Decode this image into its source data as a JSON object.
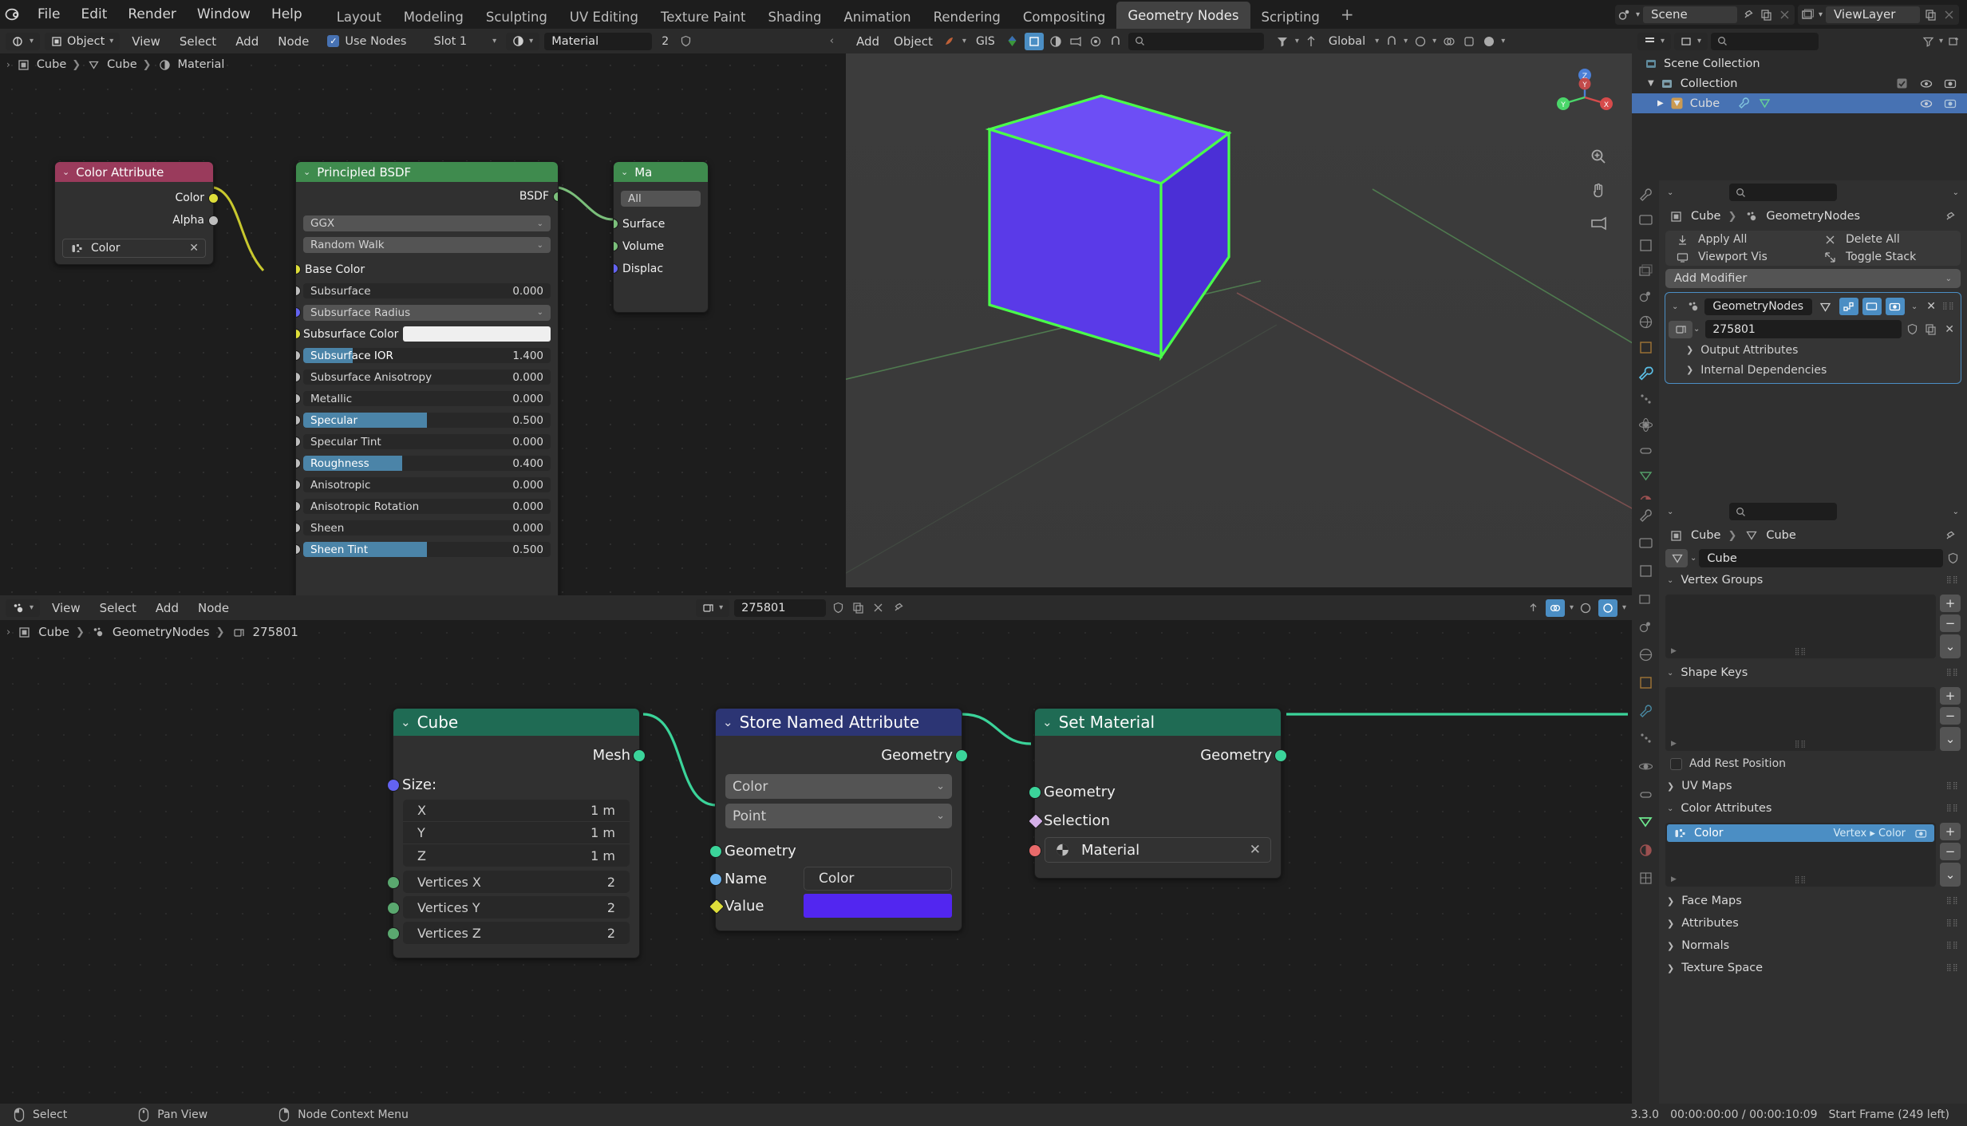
{
  "topbar": {
    "menus": [
      "File",
      "Edit",
      "Render",
      "Window",
      "Help"
    ],
    "workspaces": [
      "Layout",
      "Modeling",
      "Sculpting",
      "UV Editing",
      "Texture Paint",
      "Shading",
      "Animation",
      "Rendering",
      "Compositing",
      "Geometry Nodes",
      "Scripting"
    ],
    "active_workspace": "Geometry Nodes",
    "add_workspace": "+",
    "scene_name": "Scene",
    "viewlayer_name": "ViewLayer"
  },
  "shader_editor": {
    "header": {
      "mode": "Object",
      "menus": [
        "View",
        "Select",
        "Add",
        "Node"
      ],
      "use_nodes_label": "Use Nodes",
      "use_nodes_checked": true,
      "slot": "Slot 1",
      "material_name": "Material",
      "material_users": "2"
    },
    "breadcrumb": [
      "Cube",
      "Cube",
      "Material"
    ],
    "nodes": {
      "color_attribute": {
        "title": "Color Attribute",
        "header_color": "#9a3b5c",
        "outputs": [
          "Color",
          "Alpha"
        ],
        "attribute_name": "Color"
      },
      "principled": {
        "title": "Principled BSDF",
        "header_color": "#3f8b4e",
        "output_label": "BSDF",
        "distribution": "GGX",
        "subsurface_method": "Random Walk",
        "base_color_label": "Base Color",
        "subsurface_color_label": "Subsurface Color",
        "subsurface_color": "#efefef",
        "params": [
          {
            "name": "Subsurface",
            "value": "0.000",
            "fill": 0
          },
          {
            "name": "Subsurface IOR",
            "value": "1.400",
            "fill": 0.2
          },
          {
            "name": "Subsurface Anisotropy",
            "value": "0.000",
            "fill": 0
          },
          {
            "name": "Metallic",
            "value": "0.000",
            "fill": 0
          },
          {
            "name": "Specular",
            "value": "0.500",
            "fill": 0.5
          },
          {
            "name": "Specular Tint",
            "value": "0.000",
            "fill": 0
          },
          {
            "name": "Roughness",
            "value": "0.400",
            "fill": 0.4
          },
          {
            "name": "Anisotropic",
            "value": "0.000",
            "fill": 0
          },
          {
            "name": "Anisotropic Rotation",
            "value": "0.000",
            "fill": 0
          },
          {
            "name": "Sheen",
            "value": "0.000",
            "fill": 0
          },
          {
            "name": "Sheen Tint",
            "value": "0.500",
            "fill": 0.5
          }
        ],
        "subsurface_radius_label": "Subsurface Radius"
      },
      "material_output": {
        "title": "Ma",
        "header_color": "#3f8b4e",
        "target": "All",
        "inputs": [
          "Surface",
          "Volume",
          "Displac"
        ]
      }
    }
  },
  "viewport": {
    "header": {
      "menus": [
        "Add",
        "Object"
      ],
      "gis_label": "GIS",
      "transform_orientation": "Global"
    },
    "cube_color": "#5533ee",
    "outline_color": "#4aff4a"
  },
  "geo_editor": {
    "header": {
      "menus": [
        "View",
        "Select",
        "Add",
        "Node"
      ],
      "tree_name": "275801"
    },
    "breadcrumb": [
      "Cube",
      "GeometryNodes",
      "275801"
    ],
    "nodes": {
      "cube": {
        "title": "Cube",
        "header_color": "#1f6b54",
        "output": "Mesh",
        "size_label": "Size:",
        "size": [
          {
            "axis": "X",
            "value": "1 m"
          },
          {
            "axis": "Y",
            "value": "1 m"
          },
          {
            "axis": "Z",
            "value": "1 m"
          }
        ],
        "vertices": [
          {
            "name": "Vertices X",
            "value": "2"
          },
          {
            "name": "Vertices Y",
            "value": "2"
          },
          {
            "name": "Vertices Z",
            "value": "2"
          }
        ]
      },
      "store_named_attribute": {
        "title": "Store Named Attribute",
        "header_color": "#2c3574",
        "output": "Geometry",
        "data_type": "Color",
        "domain": "Point",
        "input_geometry": "Geometry",
        "name_label": "Name",
        "name_value": "Color",
        "value_label": "Value",
        "value_color": "#5226f0"
      },
      "set_material": {
        "title": "Set Material",
        "header_color": "#1f6b54",
        "output": "Geometry",
        "input_geometry": "Geometry",
        "selection": "Selection",
        "material": "Material"
      }
    }
  },
  "outliner": {
    "search_placeholder": "",
    "rows": [
      {
        "label": "Scene Collection",
        "depth": 0,
        "icon": "collection-icon",
        "selected": false
      },
      {
        "label": "Collection",
        "depth": 1,
        "icon": "collection-icon",
        "selected": false
      },
      {
        "label": "Cube",
        "depth": 2,
        "icon": "object-icon",
        "selected": true
      }
    ]
  },
  "properties_modifier": {
    "breadcrumb": [
      "Cube",
      "GeometryNodes"
    ],
    "operations": [
      {
        "label": "Apply All",
        "icon": "download-icon"
      },
      {
        "label": "Delete All",
        "icon": "x-icon"
      },
      {
        "label": "Viewport Vis",
        "icon": "monitor-icon"
      },
      {
        "label": "Toggle Stack",
        "icon": "expand-icon"
      }
    ],
    "add_modifier": "Add Modifier",
    "modifier_name": "GeometryNodes",
    "node_group_name": "275801",
    "sections": [
      "Output Attributes",
      "Internal Dependencies"
    ]
  },
  "properties_data": {
    "breadcrumb": [
      "Cube",
      "Cube"
    ],
    "mesh_name": "Cube",
    "panels": [
      {
        "label": "Vertex Groups",
        "open": true
      },
      {
        "label": "Shape Keys",
        "open": true
      },
      {
        "label": "UV Maps",
        "open": false
      },
      {
        "label": "Color Attributes",
        "open": true
      },
      {
        "label": "Face Maps",
        "open": false
      },
      {
        "label": "Attributes",
        "open": false
      },
      {
        "label": "Normals",
        "open": false
      },
      {
        "label": "Texture Space",
        "open": false
      }
    ],
    "add_rest_position": "Add Rest Position",
    "color_attribute": {
      "name": "Color",
      "domain_type": "Vertex ▸ Color"
    }
  },
  "statusbar": {
    "items": [
      {
        "icon": "mouse-left-icon",
        "label": "Select"
      },
      {
        "icon": "mouse-middle-icon",
        "label": "Pan View"
      },
      {
        "icon": "mouse-right-icon",
        "label": "Node Context Menu"
      }
    ],
    "version": "3.3.0",
    "timecode": "00:00:00:00 / 00:00:10:09",
    "frame_info": "Start Frame (249 left)"
  }
}
